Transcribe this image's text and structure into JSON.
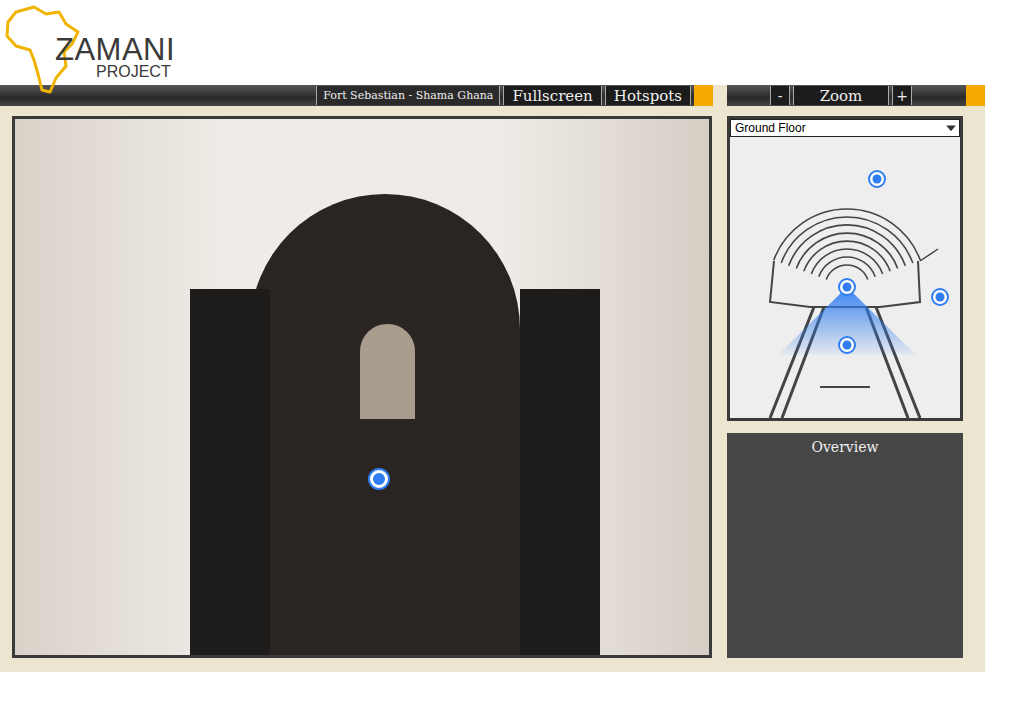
{
  "logo": {
    "name": "ZAMANI",
    "sub": "PROJECT"
  },
  "toolbar": {
    "title": "Fort Sebastian - Shama Ghana",
    "buttons": [
      "Fullscreen",
      "Hotspots"
    ]
  },
  "zoom": {
    "out": "-",
    "label": "Zoom",
    "in": "+"
  },
  "map": {
    "floor": "Ground Floor"
  },
  "overview": {
    "title": "Overview"
  }
}
